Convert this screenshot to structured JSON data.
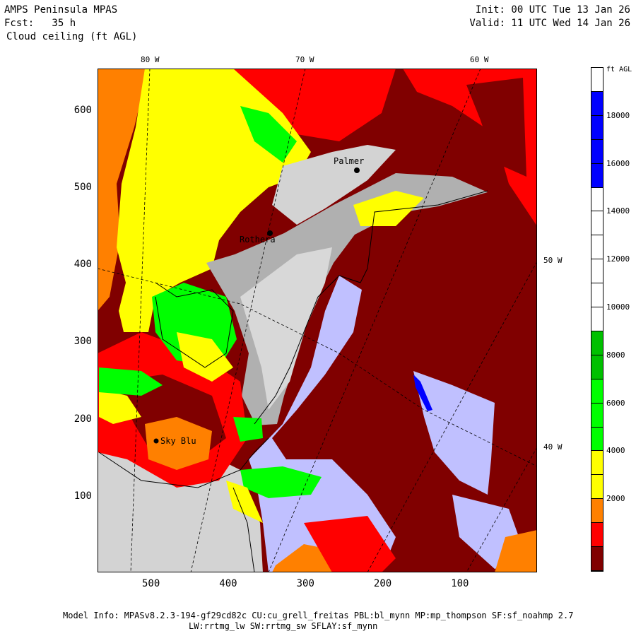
{
  "header": {
    "model": "AMPS Peninsula MPAS",
    "forecast": "Fcst:   35 h",
    "field": "Cloud ceiling (ft AGL)",
    "init": "Init: 00 UTC Tue 13 Jan 26",
    "valid": "Valid: 11 UTC Wed 14 Jan 26"
  },
  "map": {
    "lon_labels_top": [
      "80 W",
      "70 W",
      "60 W"
    ],
    "lon_labels_right": [
      "50 W",
      "40 W"
    ],
    "y_ticks": [
      600,
      500,
      400,
      300,
      200,
      100
    ],
    "x_ticks": [
      500,
      400,
      300,
      200,
      100
    ],
    "stations": [
      {
        "name": "Palmer"
      },
      {
        "name": "Rothera"
      },
      {
        "name": "Sky Blu"
      }
    ]
  },
  "colorbar": {
    "units": "ft AGL",
    "range": [
      0,
      20000
    ],
    "step": 1000,
    "colors_top_to_bottom": [
      "#ffffff",
      "#0000ff",
      "#0000ff",
      "#0000ff",
      "#0000ff",
      "#ffffff",
      "#ffffff",
      "#ffffff",
      "#ffffff",
      "#ffffff",
      "#ffffff",
      "#00c000",
      "#00c000",
      "#00ff00",
      "#00ff00",
      "#00ff00",
      "#ffff00",
      "#ffff00",
      "#ff8000",
      "#ff0000",
      "#800000"
    ],
    "labels": [
      "18000",
      "16000",
      "14000",
      "12000",
      "10000",
      "8000",
      "6000",
      "4000",
      "2000"
    ]
  },
  "footer": {
    "line1": "Model Info: MPASv8.2.3-194-gf29cd82c CU:cu_grell_freitas PBL:bl_mynn MP:mp_thompson SF:sf_noahmp 2.7",
    "line2": "LW:rrtmg_lw SW:rrtmg_sw SFLAY:sf_mynn"
  }
}
